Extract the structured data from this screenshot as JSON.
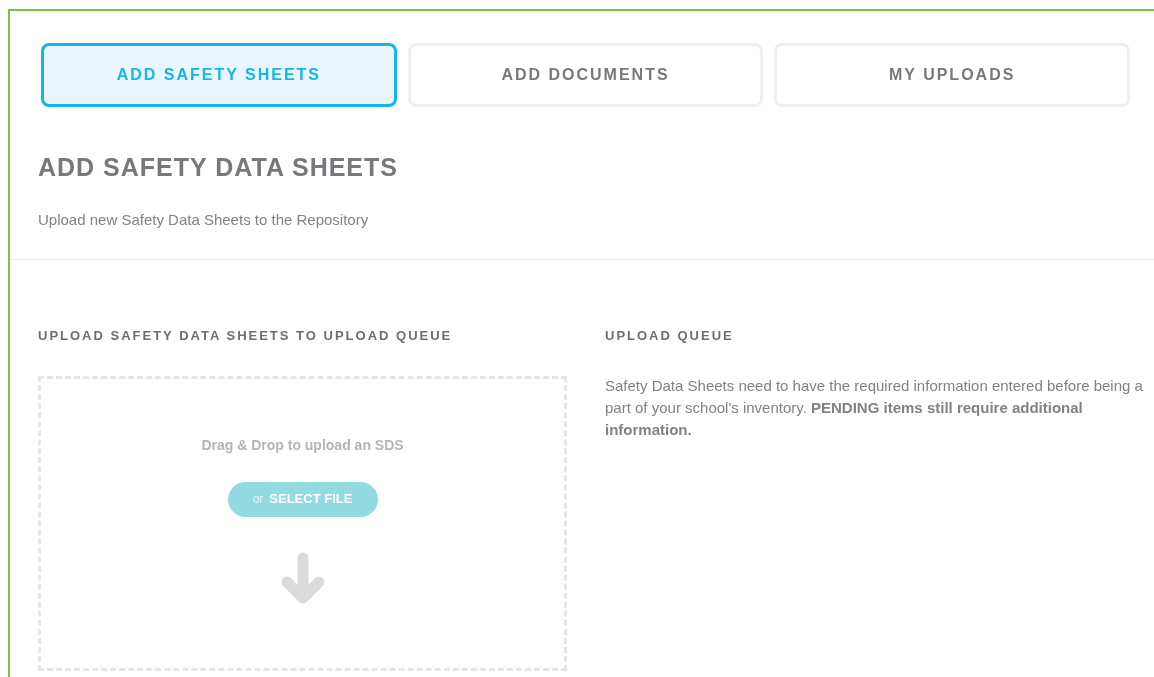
{
  "tabs": [
    {
      "label": "ADD SAFETY SHEETS",
      "selected": true
    },
    {
      "label": "ADD DOCUMENTS",
      "selected": false
    },
    {
      "label": "MY UPLOADS",
      "selected": false
    }
  ],
  "page_title": "ADD SAFETY DATA SHEETS",
  "page_subtitle": "Upload new Safety Data Sheets to the Repository",
  "upload_panel": {
    "heading": "UPLOAD SAFETY DATA SHEETS TO UPLOAD QUEUE",
    "dropzone_text": "Drag & Drop to upload an SDS",
    "select_button": {
      "prefix": "or",
      "label": "SELECT FILE"
    }
  },
  "queue_panel": {
    "heading": "UPLOAD QUEUE",
    "description": "Safety Data Sheets need to have the required information entered before being a part of your school's inventory. **PENDING items still require additional information.**"
  }
}
